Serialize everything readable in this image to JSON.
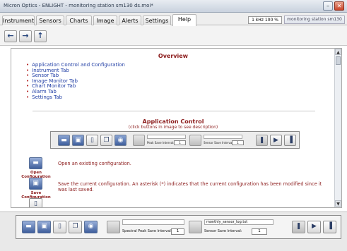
{
  "window": {
    "title": "Micron Optics - ENLIGHT - monitoring station sm130 ds.moi*",
    "minimize_glyph": "–",
    "close_glyph": "✕"
  },
  "tabs": [
    {
      "label": "Instrument",
      "active": false
    },
    {
      "label": "Sensors",
      "active": false
    },
    {
      "label": "Charts",
      "active": false
    },
    {
      "label": "Image",
      "active": false
    },
    {
      "label": "Alerts",
      "active": false
    },
    {
      "label": "Settings",
      "active": false
    },
    {
      "label": "Help",
      "active": true
    }
  ],
  "status": {
    "rate_zoom": "1 kHz  100 %",
    "station": "monitoring station sm130"
  },
  "nav": {
    "back_icon": "arrow-left-icon",
    "forward_icon": "arrow-right-icon",
    "up_icon": "arrow-up-icon"
  },
  "help": {
    "overview_title": "Overview",
    "toc": [
      "Application Control and Configuration",
      "Instrument Tab",
      "Sensor Tab",
      "Image Monitor Tab",
      "Chart Monitor Tab",
      "Alarm Tab",
      "Settings Tab"
    ],
    "app_control_title": "Application Control",
    "app_control_subtitle": "(click buttons in image to see description)",
    "mini_toolbar": {
      "spectral_label": "Peak Save Interval:",
      "spectral_value": "1",
      "sensor_label": "Sensor Save Interval:",
      "sensor_value": "1"
    },
    "items": [
      {
        "label_line1": "Open",
        "label_line2": "Configuration",
        "desc": "Open an existing configuration.",
        "icon": "folder-open-icon"
      },
      {
        "label_line1": "Save",
        "label_line2": "Configuration",
        "desc": "Save the current configuration. An asterisk (*) indicates that the current configuration has been modified since it was last saved.",
        "icon": "save-disk-icon"
      },
      {
        "label_line1": "",
        "label_line2": "",
        "desc": "",
        "icon": "new-document-icon"
      }
    ]
  },
  "bottom_toolbar": {
    "spectral_label": "Spectral Peak Save Interval:",
    "spectral_value": "1",
    "sensor_log_file": "monthly_sensor_log.txt",
    "sensor_label": "Sensor Save Interval:",
    "sensor_value": "1"
  }
}
